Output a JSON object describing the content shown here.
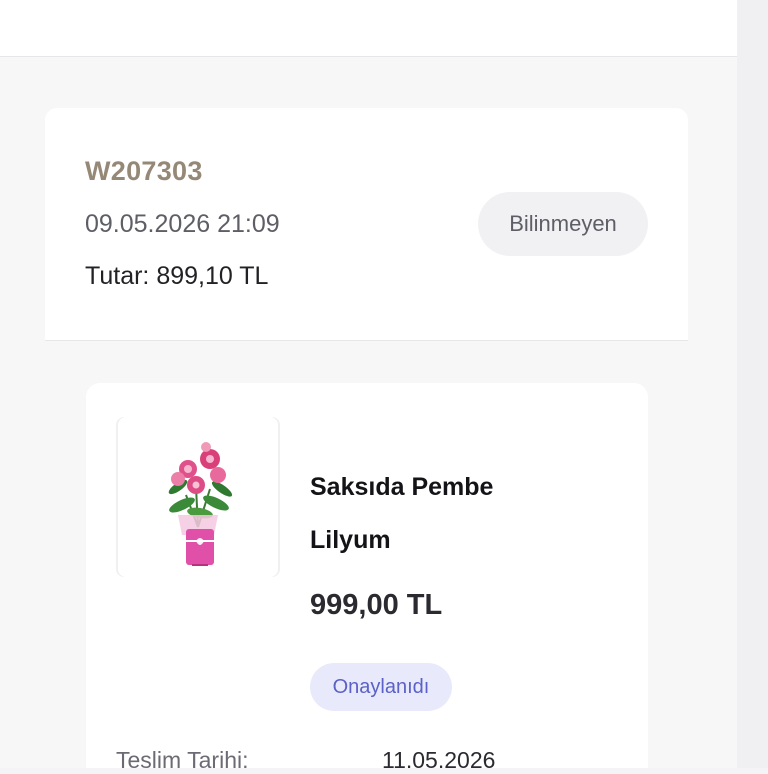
{
  "order": {
    "id": "W207303",
    "datetime": "09.05.2026 21:09",
    "total": "Tutar: 899,10 TL",
    "status": "Bilinmeyen"
  },
  "item": {
    "name_line1": "Saksıda Pembe",
    "name_line2": "Lilyum",
    "price": "999,00 TL",
    "status": "Onaylanıdı",
    "image_icon": "potted-pink-lily-image",
    "delivery_label": "Teslim Tarihi:",
    "delivery_date": "11.05.2026"
  },
  "colors": {
    "order_id": "#958877",
    "approved_bg": "#e8eafb",
    "approved_text": "#5b61c6",
    "pot_pink": "#e04fa8"
  }
}
